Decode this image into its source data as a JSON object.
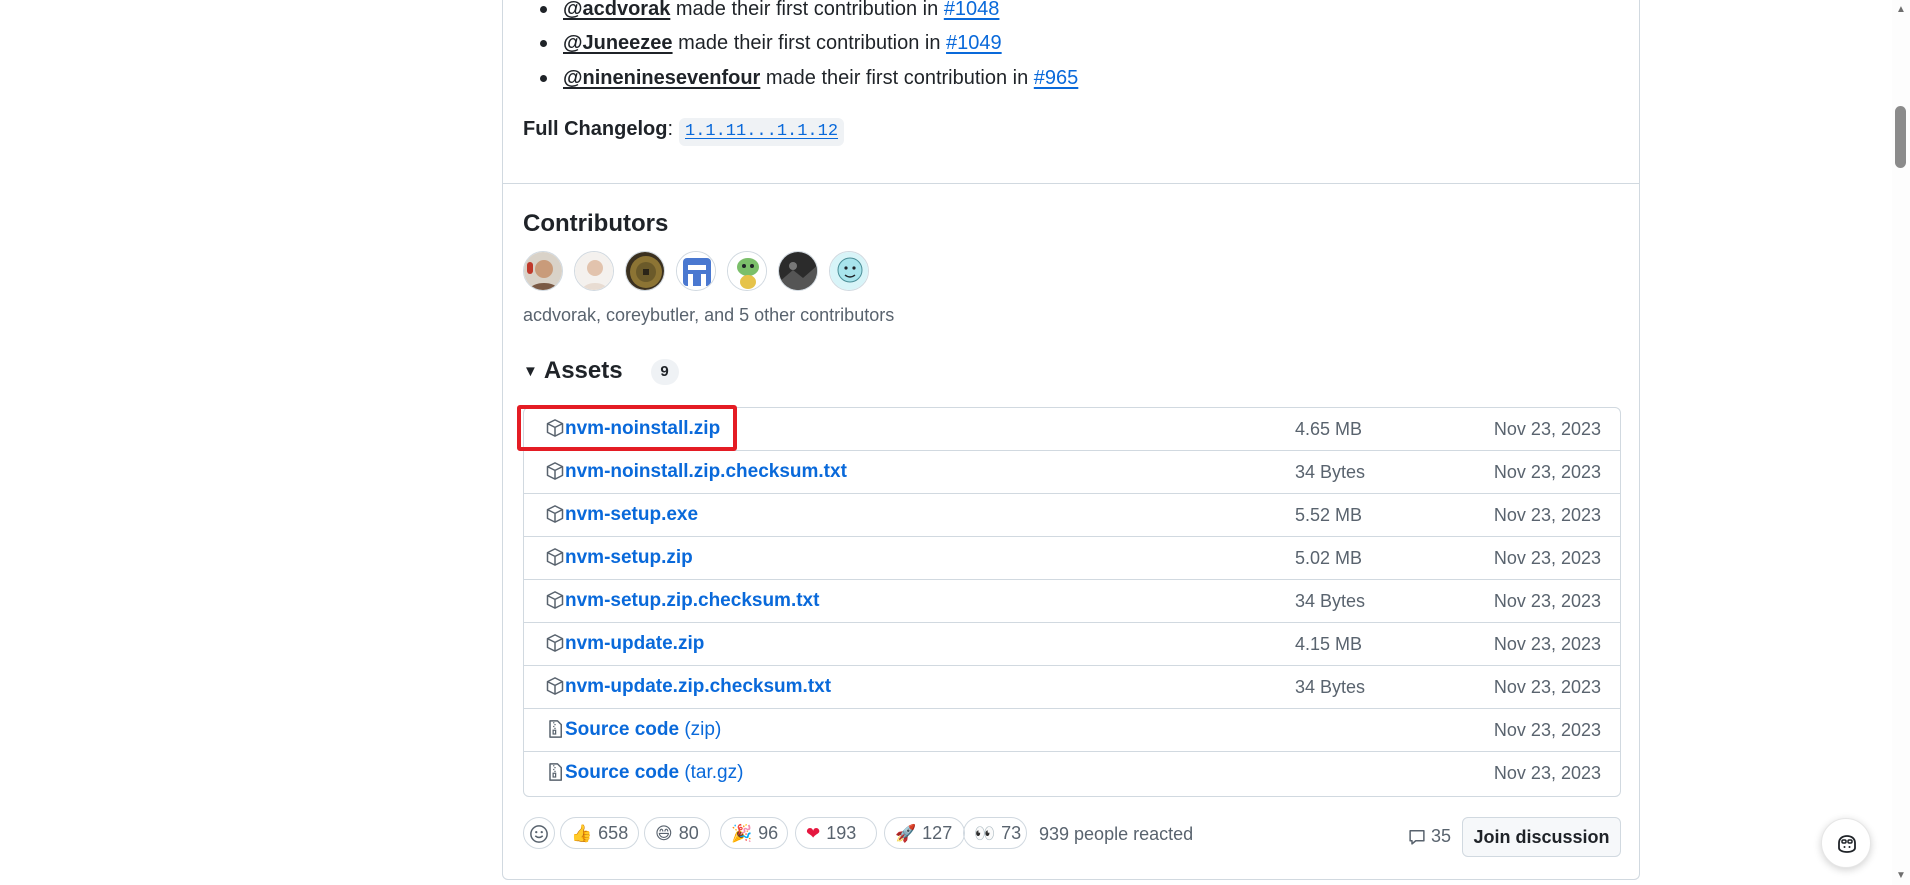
{
  "release_notes": {
    "new_contributors": [
      {
        "handle": "@acdvorak",
        "text": " made their first contribution in ",
        "pr": "#1048"
      },
      {
        "handle": "@Juneezee",
        "text": " made their first contribution in ",
        "pr": "#1049"
      },
      {
        "handle": "@nineninesevenfour",
        "text": " made their first contribution in ",
        "pr": "#965"
      }
    ],
    "changelog_label": "Full Changelog",
    "changelog_colon": ":",
    "changelog_range": "1.1.11...1.1.12"
  },
  "contributors": {
    "title": "Contributors",
    "avatar_colors": [
      "#7a5a45",
      "#e8dcd2",
      "#6b5a2a",
      "#4a78d0",
      "#7bbf6a",
      "#3a3a3a",
      "#a8e4ec"
    ],
    "summary": "acdvorak, coreybutler, and 5 other contributors"
  },
  "assets": {
    "title": "Assets",
    "count": "9",
    "items": [
      {
        "name": "nvm-noinstall.zip",
        "ext": "",
        "size": "4.65 MB",
        "date": "Nov 23, 2023",
        "icon": "package-icon"
      },
      {
        "name": "nvm-noinstall.zip.checksum.txt",
        "ext": "",
        "size": "34 Bytes",
        "date": "Nov 23, 2023",
        "icon": "package-icon"
      },
      {
        "name": "nvm-setup.exe",
        "ext": "",
        "size": "5.52 MB",
        "date": "Nov 23, 2023",
        "icon": "package-icon"
      },
      {
        "name": "nvm-setup.zip",
        "ext": "",
        "size": "5.02 MB",
        "date": "Nov 23, 2023",
        "icon": "package-icon"
      },
      {
        "name": "nvm-setup.zip.checksum.txt",
        "ext": "",
        "size": "34 Bytes",
        "date": "Nov 23, 2023",
        "icon": "package-icon"
      },
      {
        "name": "nvm-update.zip",
        "ext": "",
        "size": "4.15 MB",
        "date": "Nov 23, 2023",
        "icon": "package-icon"
      },
      {
        "name": "nvm-update.zip.checksum.txt",
        "ext": "",
        "size": "34 Bytes",
        "date": "Nov 23, 2023",
        "icon": "package-icon"
      },
      {
        "name": "Source code",
        "ext": " (zip)",
        "size": "",
        "date": "Nov 23, 2023",
        "icon": "file-zip-icon"
      },
      {
        "name": "Source code",
        "ext": " (tar.gz)",
        "size": "",
        "date": "Nov 23, 2023",
        "icon": "file-zip-icon"
      }
    ]
  },
  "reactions": {
    "items": [
      {
        "emoji": "👍",
        "count": "658",
        "name": "thumbs-up"
      },
      {
        "emoji": "😄",
        "count": "80",
        "name": "laugh"
      },
      {
        "emoji": "🎉",
        "count": "96",
        "name": "hooray"
      },
      {
        "emoji": "❤",
        "count": "193",
        "name": "heart"
      },
      {
        "emoji": "🚀",
        "count": "127",
        "name": "rocket"
      },
      {
        "emoji": "👀",
        "count": "73",
        "name": "eyes"
      }
    ],
    "summary": "939 people reacted"
  },
  "discussion": {
    "comments": "35",
    "join_label": "Join discussion"
  }
}
